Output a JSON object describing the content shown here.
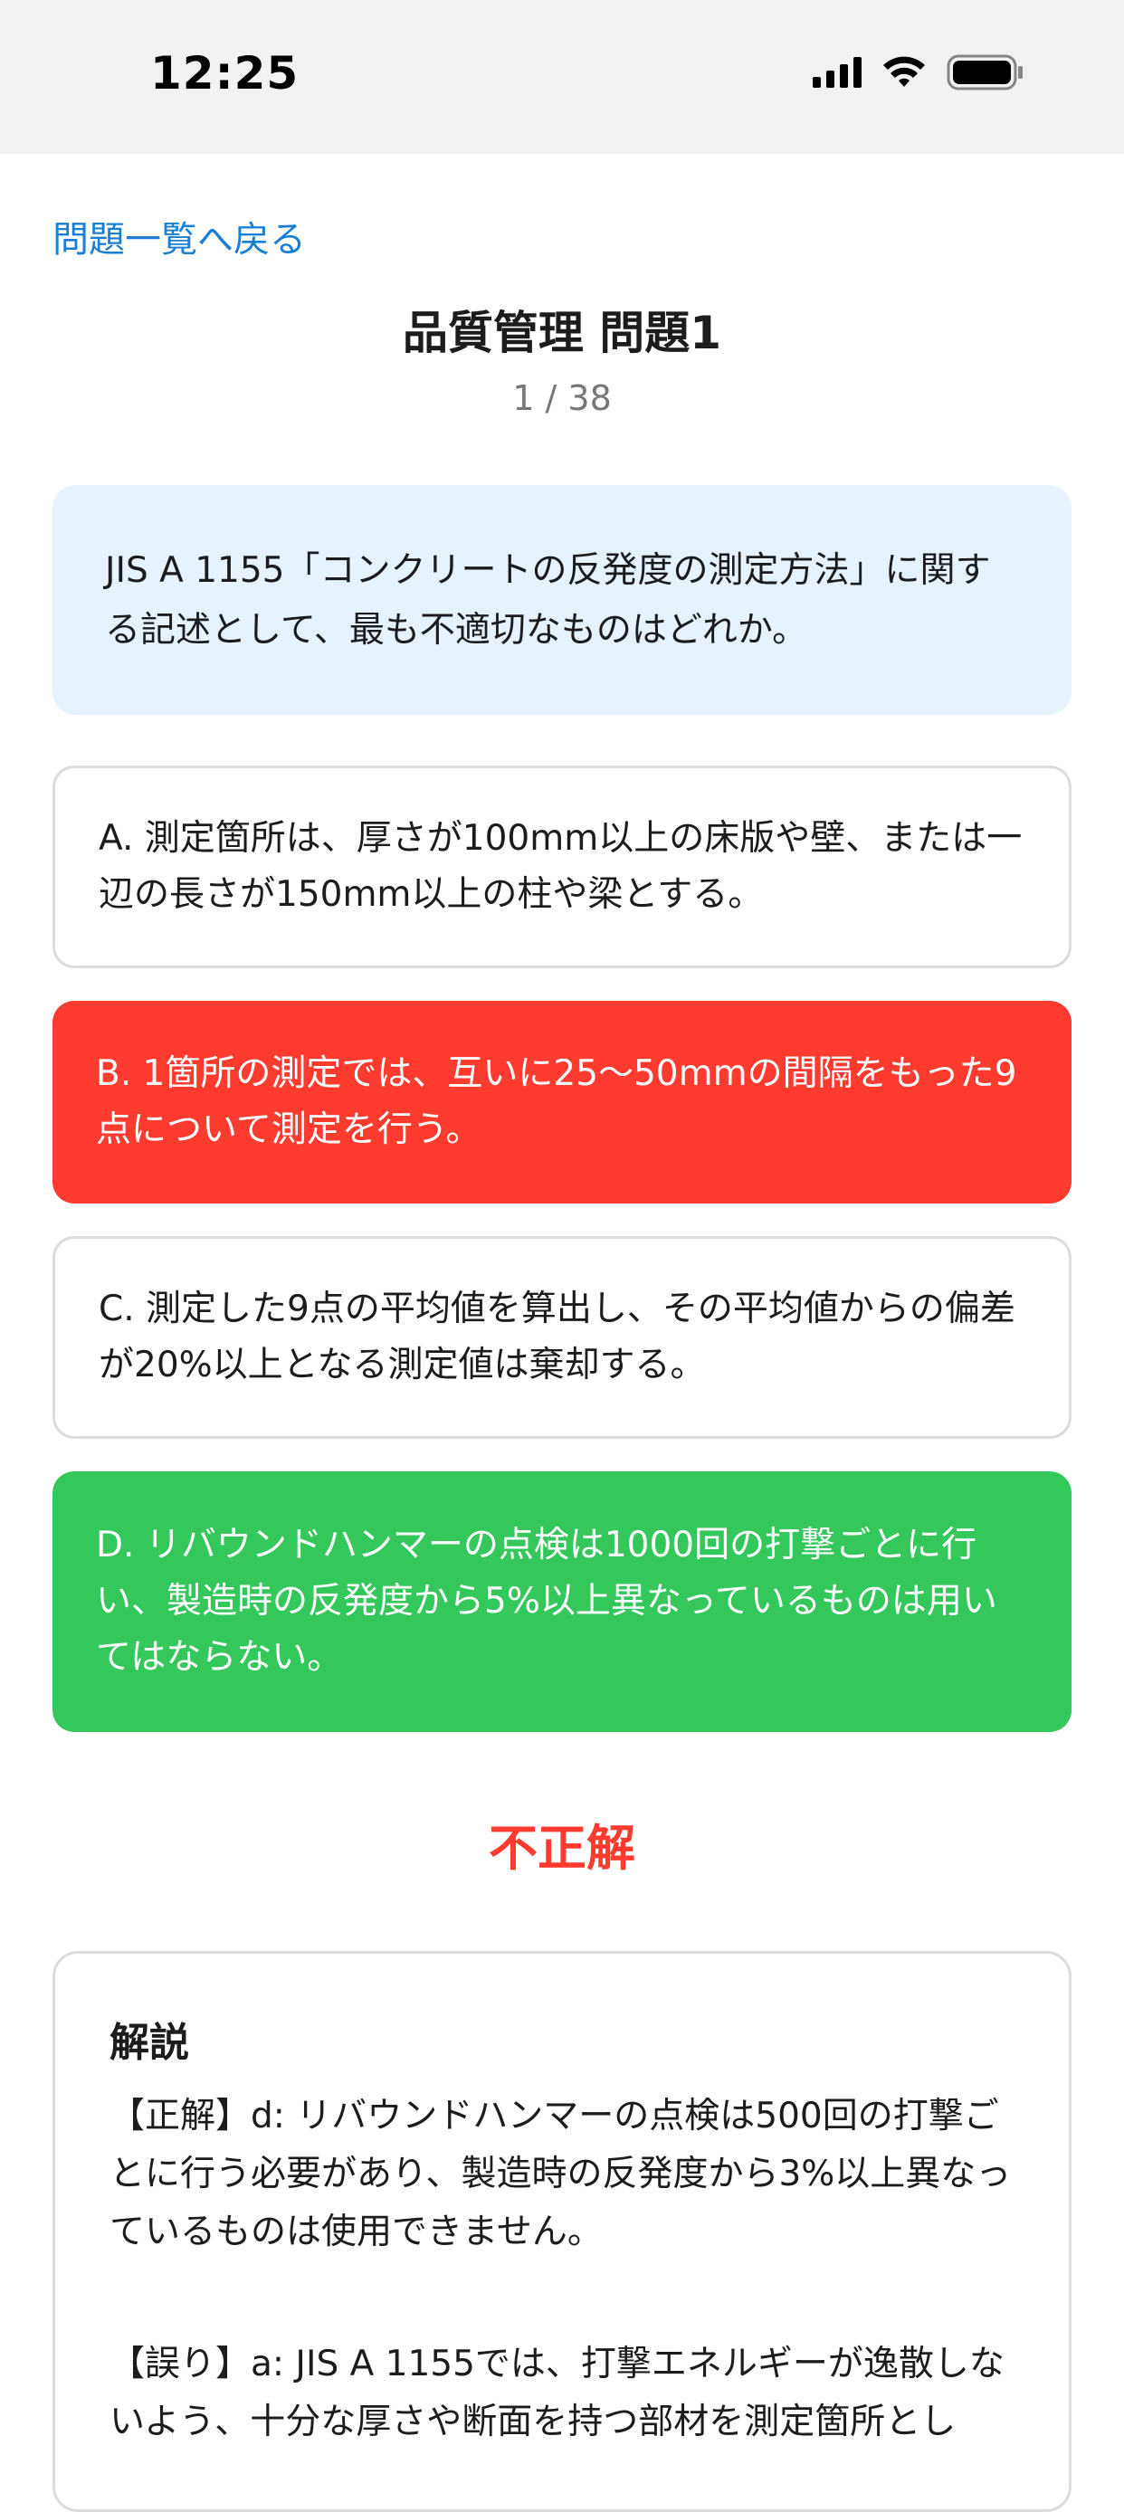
{
  "status_bar": {
    "time": "12:25"
  },
  "nav": {
    "back_label": "問題一覧へ戻る"
  },
  "header": {
    "title": "品質管理 問題1",
    "progress": "1 / 38"
  },
  "question": {
    "text": "JIS A 1155「コンクリートの反発度の測定方法」に関する記述として、最も不適切なものはどれか。"
  },
  "options": [
    {
      "label": "A. 測定箇所は、厚さが100mm以上の床版や壁、または一辺の長さが150mm以上の柱や梁とする。",
      "state": "neutral"
    },
    {
      "label": "B. 1箇所の測定では、互いに25〜50mmの間隔をもった9点について測定を行う。",
      "state": "wrong"
    },
    {
      "label": "C. 測定した9点の平均値を算出し、その平均値からの偏差が20%以上となる測定値は棄却する。",
      "state": "neutral"
    },
    {
      "label": "D. リバウンドハンマーの点検は1000回の打撃ごとに行い、製造時の反発度から5%以上異なっているものは用いてはならない。",
      "state": "correct"
    }
  ],
  "result": {
    "text": "不正解",
    "color": "#ff3b30"
  },
  "explanation": {
    "title": "解説",
    "paragraphs": [
      "【正解】d: リバウンドハンマーの点検は500回の打撃ごとに行う必要があり、製造時の反発度から3%以上異なっているものは使用できません。",
      "【誤り】a: JIS A 1155では、打撃エネルギーが逸散しないよう、十分な厚さや断面を持つ部材を測定箇所とし"
    ]
  },
  "colors": {
    "accent": "#1a7fd4",
    "wrong": "#ff3b30",
    "correct": "#34c759",
    "question_bg": "#e6f2fd"
  }
}
